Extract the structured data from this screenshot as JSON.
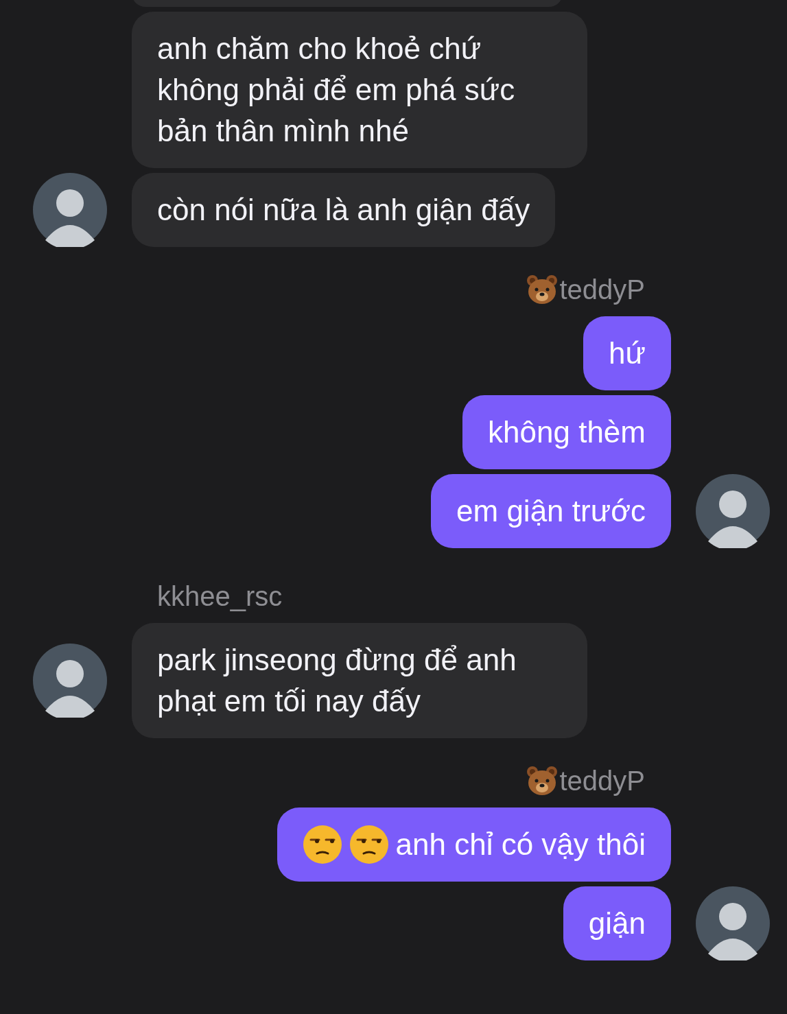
{
  "groups": [
    {
      "kind": "incoming",
      "clipped_above": true,
      "messages": [
        {
          "text": "anh chăm cho khoẻ chứ không phải để em phá sức bản thân mình nhé"
        },
        {
          "text": "còn nói nữa là anh giận đấy"
        }
      ]
    },
    {
      "kind": "outgoing",
      "sender": "teddyP",
      "sender_bear": true,
      "messages": [
        {
          "text": "hứ"
        },
        {
          "text": "không thèm"
        },
        {
          "text": "em giận trước"
        }
      ]
    },
    {
      "kind": "incoming",
      "sender": "kkhee_rsc",
      "messages": [
        {
          "text": "park jinseong đừng để anh phạt em tối nay đấy"
        }
      ]
    },
    {
      "kind": "outgoing",
      "sender": "teddyP",
      "sender_bear": true,
      "messages": [
        {
          "text": "anh chỉ có vậy thôi",
          "emoji_prefix": true
        },
        {
          "text": "giận"
        }
      ]
    }
  ]
}
